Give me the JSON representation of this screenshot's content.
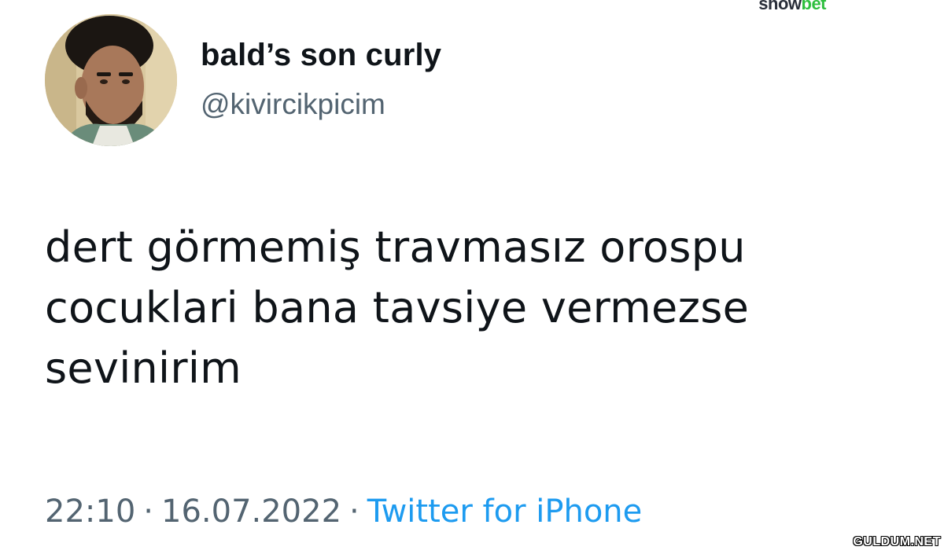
{
  "watermarks": {
    "top_part1": "show",
    "top_part2": "bet",
    "bottom": "GULDUM.NET"
  },
  "tweet": {
    "display_name": "bald’s son curly",
    "username": "@kivircikpicim",
    "text_lines": [
      "dert görmemiş travmasız orospu",
      "cocuklari bana tavsiye vermezse",
      "sevinirim"
    ],
    "time": "22:10",
    "separator": "·",
    "date": "16.07.2022",
    "source": "Twitter for iPhone"
  },
  "colors": {
    "text": "#0f1419",
    "secondary": "#536471",
    "link": "#1d9bf0",
    "brand_green": "#2fbf3f"
  },
  "icons": {
    "avatar": "profile-photo"
  }
}
